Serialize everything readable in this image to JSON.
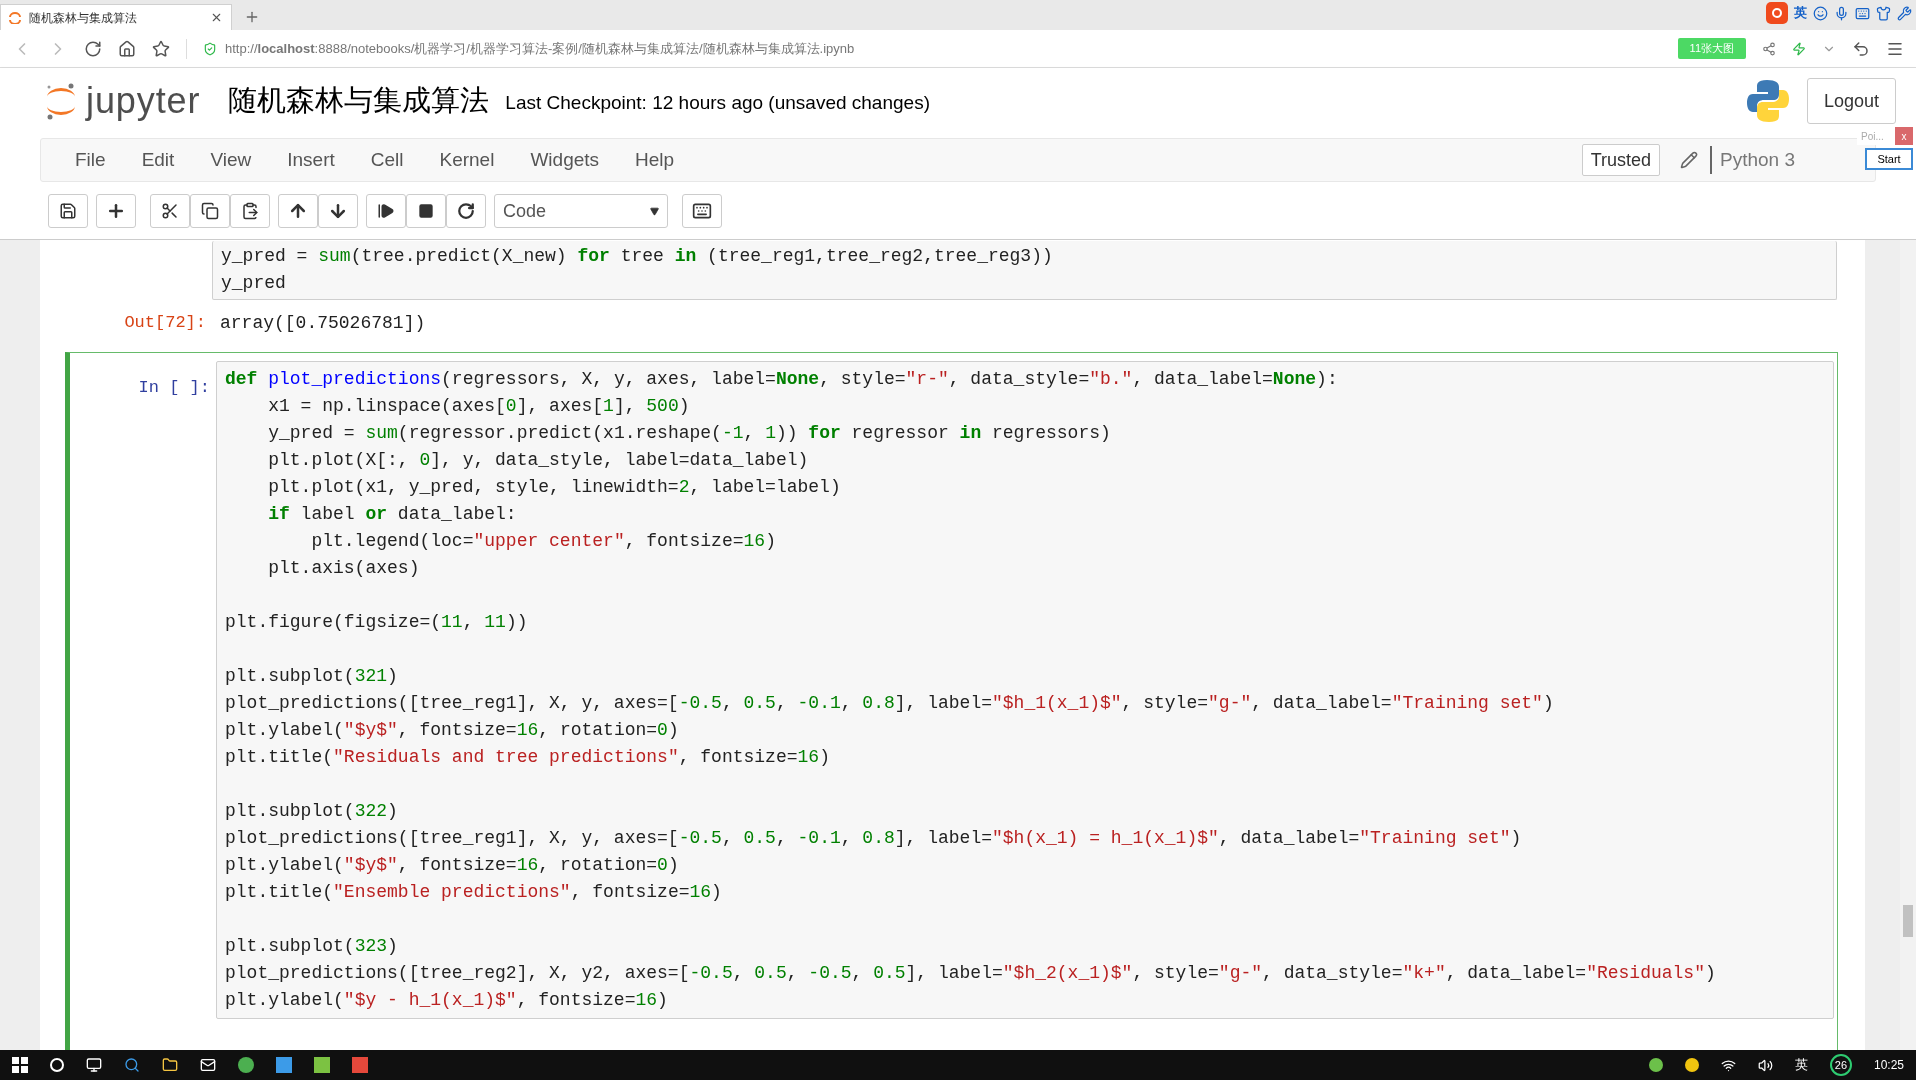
{
  "browser": {
    "tab_title": "随机森林与集成算法",
    "url": "http://**localhost**:8888/notebooks/机器学习/机器学习算法-案例/随机森林与集成算法/随机森林与集成算法.ipynb",
    "badge": "11张大图",
    "ime": "英"
  },
  "header": {
    "logo_text": "jupyter",
    "title": "随机森林与集成算法",
    "checkpoint": "Last Checkpoint: 12 hours ago (unsaved changes)",
    "logout": "Logout"
  },
  "menu": [
    {
      "label": "File"
    },
    {
      "label": "Edit"
    },
    {
      "label": "View"
    },
    {
      "label": "Insert"
    },
    {
      "label": "Cell"
    },
    {
      "label": "Kernel"
    },
    {
      "label": "Widgets"
    },
    {
      "label": "Help"
    }
  ],
  "trusted": "Trusted",
  "kernel": "Python 3",
  "popup": {
    "title": "Poi...",
    "close": "x",
    "button": "Start"
  },
  "toolbar": {
    "cell_type": "Code"
  },
  "cells": [
    {
      "selected": false,
      "lines": [
        {
          "tokens": [
            {
              "kind": "plain",
              "text": "y_pred = "
            },
            {
              "kind": "builtin",
              "text": "sum"
            },
            {
              "kind": "plain",
              "text": "(tree.predict(X_new) "
            },
            {
              "kind": "keyword",
              "text": "for"
            },
            {
              "kind": "plain",
              "text": " tree "
            },
            {
              "kind": "keyword",
              "text": "in"
            },
            {
              "kind": "plain",
              "text": " (tree_reg1,tree_reg2,tree_reg3))"
            }
          ]
        },
        {
          "tokens": [
            {
              "kind": "plain",
              "text": "y_pred"
            }
          ]
        }
      ],
      "output": {
        "prompt": "Out[72]:",
        "text": "array([0.75026781])"
      }
    },
    {
      "selected": true,
      "prompt": "In [ ]:",
      "lines": [
        {
          "tokens": [
            {
              "kind": "keyword",
              "text": "def "
            },
            {
              "kind": "def",
              "text": "plot_predictions"
            },
            {
              "kind": "plain",
              "text": "(regressors, X, y, axes, label="
            },
            {
              "kind": "keyword",
              "text": "None"
            },
            {
              "kind": "plain",
              "text": ", style="
            },
            {
              "kind": "string",
              "text": "\"r-\""
            },
            {
              "kind": "plain",
              "text": ", data_style="
            },
            {
              "kind": "string",
              "text": "\"b.\""
            },
            {
              "kind": "plain",
              "text": ", data_label="
            },
            {
              "kind": "keyword",
              "text": "None"
            },
            {
              "kind": "plain",
              "text": "):"
            }
          ]
        },
        {
          "tokens": [
            {
              "kind": "plain",
              "text": "    x1 = np.linspace(axes["
            },
            {
              "kind": "number",
              "text": "0"
            },
            {
              "kind": "plain",
              "text": "], axes["
            },
            {
              "kind": "number",
              "text": "1"
            },
            {
              "kind": "plain",
              "text": "], "
            },
            {
              "kind": "number",
              "text": "500"
            },
            {
              "kind": "plain",
              "text": ")"
            }
          ]
        },
        {
          "tokens": [
            {
              "kind": "plain",
              "text": "    y_pred = "
            },
            {
              "kind": "builtin",
              "text": "sum"
            },
            {
              "kind": "plain",
              "text": "(regressor.predict(x1.reshape("
            },
            {
              "kind": "number",
              "text": "-1"
            },
            {
              "kind": "plain",
              "text": ", "
            },
            {
              "kind": "number",
              "text": "1"
            },
            {
              "kind": "plain",
              "text": ")) "
            },
            {
              "kind": "keyword",
              "text": "for"
            },
            {
              "kind": "plain",
              "text": " regressor "
            },
            {
              "kind": "keyword",
              "text": "in"
            },
            {
              "kind": "plain",
              "text": " regressors)"
            }
          ]
        },
        {
          "tokens": [
            {
              "kind": "plain",
              "text": "    plt.plot(X[:, "
            },
            {
              "kind": "number",
              "text": "0"
            },
            {
              "kind": "plain",
              "text": "], y, data_style, label=data_label)"
            }
          ]
        },
        {
          "tokens": [
            {
              "kind": "plain",
              "text": "    plt.plot(x1, y_pred, style, linewidth="
            },
            {
              "kind": "number",
              "text": "2"
            },
            {
              "kind": "plain",
              "text": ", label=label)"
            }
          ]
        },
        {
          "tokens": [
            {
              "kind": "keyword",
              "text": "    if"
            },
            {
              "kind": "plain",
              "text": " label "
            },
            {
              "kind": "keyword",
              "text": "or"
            },
            {
              "kind": "plain",
              "text": " data_label:"
            }
          ]
        },
        {
          "tokens": [
            {
              "kind": "plain",
              "text": "        plt.legend(loc="
            },
            {
              "kind": "string",
              "text": "\"upper center\""
            },
            {
              "kind": "plain",
              "text": ", fontsize="
            },
            {
              "kind": "number",
              "text": "16"
            },
            {
              "kind": "plain",
              "text": ")"
            }
          ]
        },
        {
          "tokens": [
            {
              "kind": "plain",
              "text": "    plt.axis(axes)"
            }
          ]
        },
        {
          "kind": "blank"
        },
        {
          "tokens": [
            {
              "kind": "plain",
              "text": "plt.figure(figsize=("
            },
            {
              "kind": "number",
              "text": "11"
            },
            {
              "kind": "plain",
              "text": ", "
            },
            {
              "kind": "number",
              "text": "11"
            },
            {
              "kind": "plain",
              "text": "))"
            }
          ]
        },
        {
          "kind": "blank"
        },
        {
          "tokens": [
            {
              "kind": "plain",
              "text": "plt.subplot("
            },
            {
              "kind": "number",
              "text": "321"
            },
            {
              "kind": "plain",
              "text": ")"
            }
          ]
        },
        {
          "tokens": [
            {
              "kind": "plain",
              "text": "plot_predictions([tree_reg1], X, y, axes=["
            },
            {
              "kind": "number",
              "text": "-0.5"
            },
            {
              "kind": "plain",
              "text": ", "
            },
            {
              "kind": "number",
              "text": "0.5"
            },
            {
              "kind": "plain",
              "text": ", "
            },
            {
              "kind": "number",
              "text": "-0.1"
            },
            {
              "kind": "plain",
              "text": ", "
            },
            {
              "kind": "number",
              "text": "0.8"
            },
            {
              "kind": "plain",
              "text": "], label="
            },
            {
              "kind": "string",
              "text": "\"$h_1(x_1)$\""
            },
            {
              "kind": "plain",
              "text": ", style="
            },
            {
              "kind": "string",
              "text": "\"g-\""
            },
            {
              "kind": "plain",
              "text": ", data_label="
            },
            {
              "kind": "string",
              "text": "\"Training set\""
            },
            {
              "kind": "plain",
              "text": ")"
            }
          ]
        },
        {
          "tokens": [
            {
              "kind": "plain",
              "text": "plt.ylabel("
            },
            {
              "kind": "string",
              "text": "\"$y$\""
            },
            {
              "kind": "plain",
              "text": ", fontsize="
            },
            {
              "kind": "number",
              "text": "16"
            },
            {
              "kind": "plain",
              "text": ", rotation="
            },
            {
              "kind": "number",
              "text": "0"
            },
            {
              "kind": "plain",
              "text": ")"
            }
          ]
        },
        {
          "tokens": [
            {
              "kind": "plain",
              "text": "plt.title("
            },
            {
              "kind": "string",
              "text": "\"Residuals and tree predictions\""
            },
            {
              "kind": "plain",
              "text": ", fontsize="
            },
            {
              "kind": "number",
              "text": "16"
            },
            {
              "kind": "plain",
              "text": ")"
            }
          ]
        },
        {
          "kind": "blank"
        },
        {
          "tokens": [
            {
              "kind": "plain",
              "text": "plt.subplot("
            },
            {
              "kind": "number",
              "text": "322"
            },
            {
              "kind": "plain",
              "text": ")"
            }
          ]
        },
        {
          "tokens": [
            {
              "kind": "plain",
              "text": "plot_predictions([tree_reg1], X, y, axes=["
            },
            {
              "kind": "number",
              "text": "-0.5"
            },
            {
              "kind": "plain",
              "text": ", "
            },
            {
              "kind": "number",
              "text": "0.5"
            },
            {
              "kind": "plain",
              "text": ", "
            },
            {
              "kind": "number",
              "text": "-0.1"
            },
            {
              "kind": "plain",
              "text": ", "
            },
            {
              "kind": "number",
              "text": "0.8"
            },
            {
              "kind": "plain",
              "text": "], label="
            },
            {
              "kind": "string",
              "text": "\"$h(x_1) = h_1(x_1)$\""
            },
            {
              "kind": "plain",
              "text": ", data_label="
            },
            {
              "kind": "string",
              "text": "\"Training set\""
            },
            {
              "kind": "plain",
              "text": ")"
            }
          ]
        },
        {
          "tokens": [
            {
              "kind": "plain",
              "text": "plt.ylabel("
            },
            {
              "kind": "string",
              "text": "\"$y$\""
            },
            {
              "kind": "plain",
              "text": ", fontsize="
            },
            {
              "kind": "number",
              "text": "16"
            },
            {
              "kind": "plain",
              "text": ", rotation="
            },
            {
              "kind": "number",
              "text": "0"
            },
            {
              "kind": "plain",
              "text": ")"
            }
          ]
        },
        {
          "tokens": [
            {
              "kind": "plain",
              "text": "plt.title("
            },
            {
              "kind": "string",
              "text": "\"Ensemble predictions\""
            },
            {
              "kind": "plain",
              "text": ", fontsize="
            },
            {
              "kind": "number",
              "text": "16"
            },
            {
              "kind": "plain",
              "text": ")"
            }
          ]
        },
        {
          "kind": "blank"
        },
        {
          "tokens": [
            {
              "kind": "plain",
              "text": "plt.subplot("
            },
            {
              "kind": "number",
              "text": "323"
            },
            {
              "kind": "plain",
              "text": ")"
            }
          ]
        },
        {
          "tokens": [
            {
              "kind": "plain",
              "text": "plot_predictions([tree_reg2], X, y2, axes=["
            },
            {
              "kind": "number",
              "text": "-0.5"
            },
            {
              "kind": "plain",
              "text": ", "
            },
            {
              "kind": "number",
              "text": "0.5"
            },
            {
              "kind": "plain",
              "text": ", "
            },
            {
              "kind": "number",
              "text": "-0.5"
            },
            {
              "kind": "plain",
              "text": ", "
            },
            {
              "kind": "number",
              "text": "0.5"
            },
            {
              "kind": "plain",
              "text": "], label="
            },
            {
              "kind": "string",
              "text": "\"$h_2(x_1)$\""
            },
            {
              "kind": "plain",
              "text": ", style="
            },
            {
              "kind": "string",
              "text": "\"g-\""
            },
            {
              "kind": "plain",
              "text": ", data_style="
            },
            {
              "kind": "string",
              "text": "\"k+\""
            },
            {
              "kind": "plain",
              "text": ", data_label="
            },
            {
              "kind": "string",
              "text": "\"Residuals\""
            },
            {
              "kind": "plain",
              "text": ")"
            }
          ]
        },
        {
          "tokens": [
            {
              "kind": "plain",
              "text": "plt.ylabel("
            },
            {
              "kind": "string",
              "text": "\"$y - h_1(x_1)$\""
            },
            {
              "kind": "plain",
              "text": ", fontsize="
            },
            {
              "kind": "number",
              "text": "16"
            },
            {
              "kind": "plain",
              "text": ")"
            }
          ]
        }
      ]
    }
  ],
  "taskbar": {
    "ime": "英",
    "badge": "26",
    "clock": "10:25"
  }
}
